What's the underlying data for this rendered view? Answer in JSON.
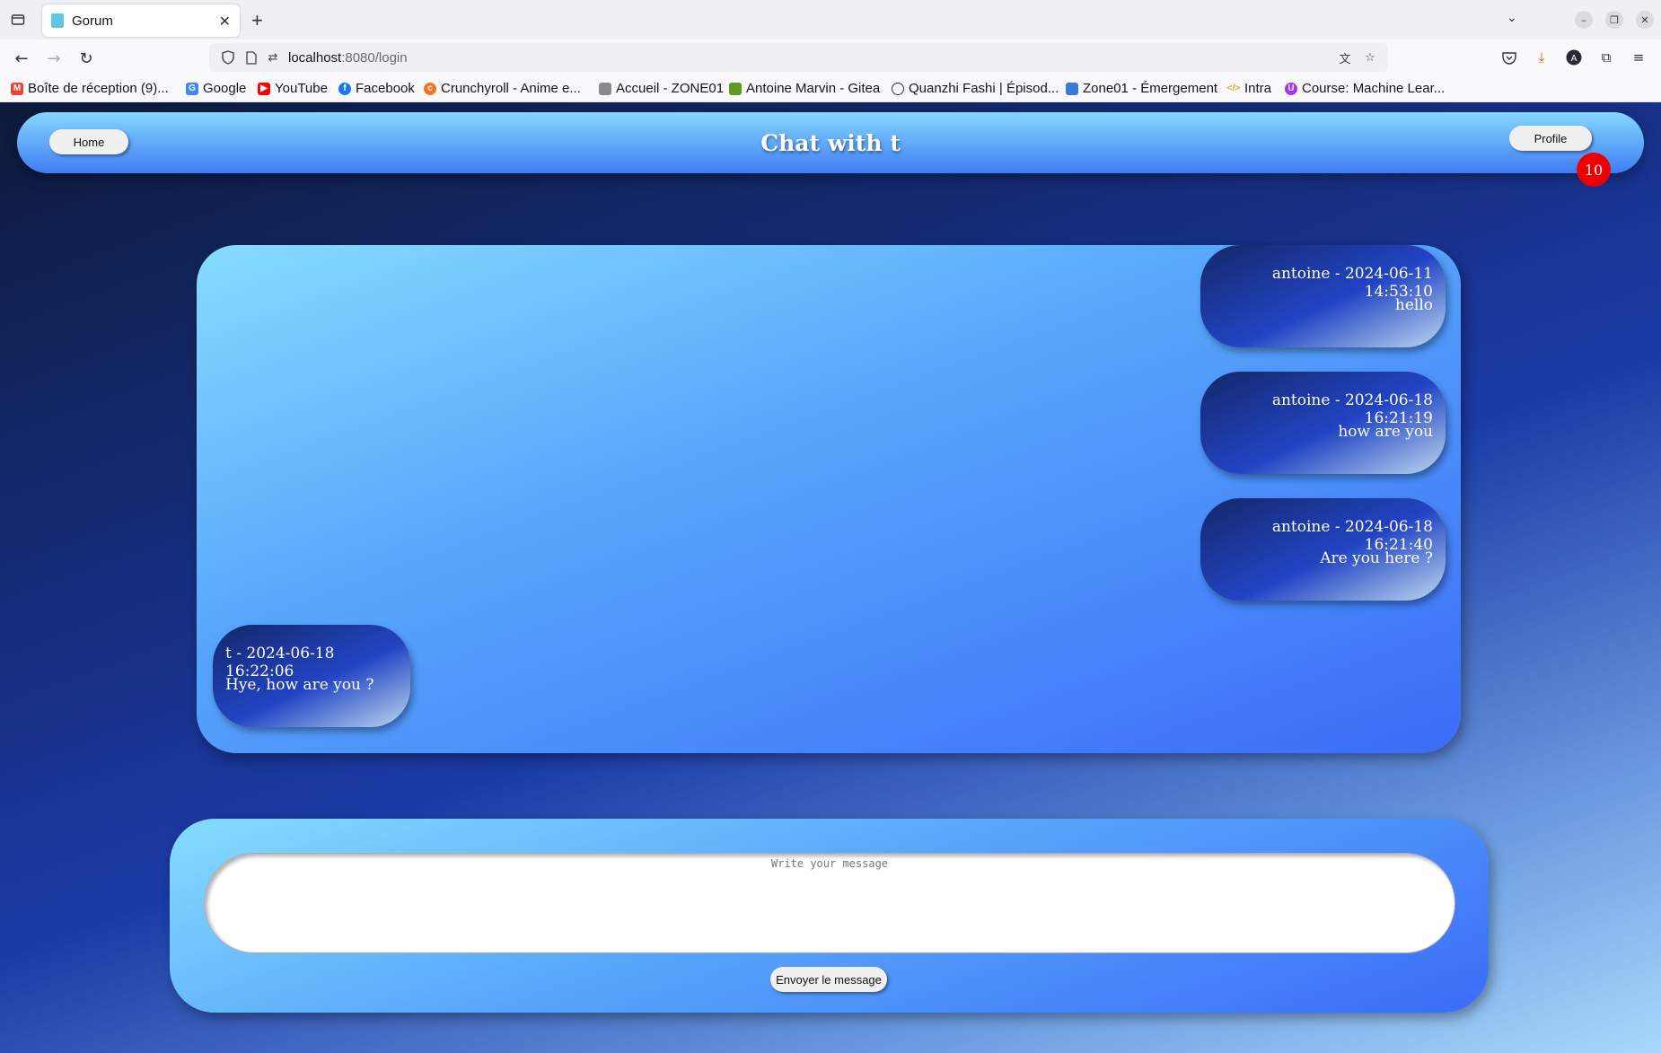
{
  "browser": {
    "tab_title": "Gorum",
    "url_host": "localhost",
    "url_path": ":8080/login",
    "bookmarks": [
      "Boîte de réception (9)...",
      "Google",
      "YouTube",
      "Facebook",
      "Crunchyroll - Anime e...",
      "Accueil - ZONE01",
      "Antoine Marvin - Gitea",
      "Quanzhi Fashi | Épisod...",
      "Zone01 - Émergement",
      "Intra",
      "Course: Machine Lear..."
    ]
  },
  "header": {
    "home_label": "Home",
    "title": "Chat with t",
    "profile_label": "Profile",
    "notification_count": "10"
  },
  "messages": [
    {
      "meta": "antoine - 2024-06-11 14:53:10",
      "text": "hello",
      "side": "right"
    },
    {
      "meta": "antoine - 2024-06-18 16:21:19",
      "text": "how are you",
      "side": "right"
    },
    {
      "meta": "antoine - 2024-06-18 16:21:40",
      "text": "Are you here ?",
      "side": "right"
    },
    {
      "meta": "t - 2024-06-18 16:22:06",
      "text": "Hye, how are you ?",
      "side": "left"
    }
  ],
  "compose": {
    "placeholder": "Write your message",
    "send_label": "Envoyer le message"
  },
  "colors": {
    "accent": "#3f7cf5",
    "badge": "#ee0000"
  }
}
